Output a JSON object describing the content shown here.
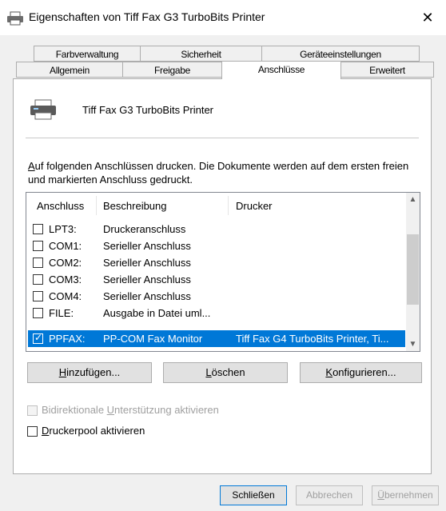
{
  "window": {
    "title": "Eigenschaften von Tiff Fax G3 TurboBits Printer",
    "close_glyph": "✕"
  },
  "tabs": {
    "row1": [
      {
        "label": "Farbverwaltung"
      },
      {
        "label": "Sicherheit"
      },
      {
        "label": "Geräteeinstellungen"
      }
    ],
    "row2": [
      {
        "label": "Allgemein"
      },
      {
        "label": "Freigabe"
      },
      {
        "label": "Anschlüsse"
      },
      {
        "label": "Erweitert"
      }
    ],
    "active": "Anschlüsse"
  },
  "printer": {
    "name": "Tiff Fax G3 TurboBits Printer",
    "icon": "printer-icon"
  },
  "description": {
    "first_char": "A",
    "rest": "uf folgenden Anschlüssen drucken. Die Dokumente werden auf dem ersten freien und markierten Anschluss gedruckt."
  },
  "port_list": {
    "columns": [
      "Anschluss",
      "Beschreibung",
      "Drucker"
    ],
    "rows": [
      {
        "port": "LPT3:",
        "description": "Druckeranschluss",
        "printer": "",
        "checked": false,
        "selected": false
      },
      {
        "port": "COM1:",
        "description": "Serieller Anschluss",
        "printer": "",
        "checked": false,
        "selected": false
      },
      {
        "port": "COM2:",
        "description": "Serieller Anschluss",
        "printer": "",
        "checked": false,
        "selected": false
      },
      {
        "port": "COM3:",
        "description": "Serieller Anschluss",
        "printer": "",
        "checked": false,
        "selected": false
      },
      {
        "port": "COM4:",
        "description": "Serieller Anschluss",
        "printer": "",
        "checked": false,
        "selected": false
      },
      {
        "port": "FILE:",
        "description": "Ausgabe in Datei uml...",
        "printer": "",
        "checked": false,
        "selected": false
      },
      {
        "port": "PPFAX:",
        "description": "PP-COM Fax Monitor",
        "printer": "Tiff Fax G4 TurboBits Printer, Ti...",
        "checked": true,
        "selected": true
      }
    ],
    "checkmark": "✓"
  },
  "buttons": {
    "add": {
      "first": "H",
      "rest": "inzufügen..."
    },
    "delete": {
      "first": "L",
      "rest": "öschen"
    },
    "configure": {
      "first": "K",
      "rest": "onfigurieren..."
    }
  },
  "options": {
    "bidi": {
      "before": "Bidirektionale ",
      "u": "U",
      "after": "nterstützung aktivieren",
      "checked": false,
      "enabled": false
    },
    "pool": {
      "before": "",
      "u": "D",
      "after": "ruckerpool aktivieren",
      "checked": false,
      "enabled": true
    }
  },
  "footer": {
    "close": "Schließen",
    "cancel": "Abbrechen",
    "apply_first": "Ü",
    "apply_rest": "bernehmen"
  },
  "colors": {
    "selection": "#0078d7",
    "window_bg": "#f0f0f0"
  }
}
